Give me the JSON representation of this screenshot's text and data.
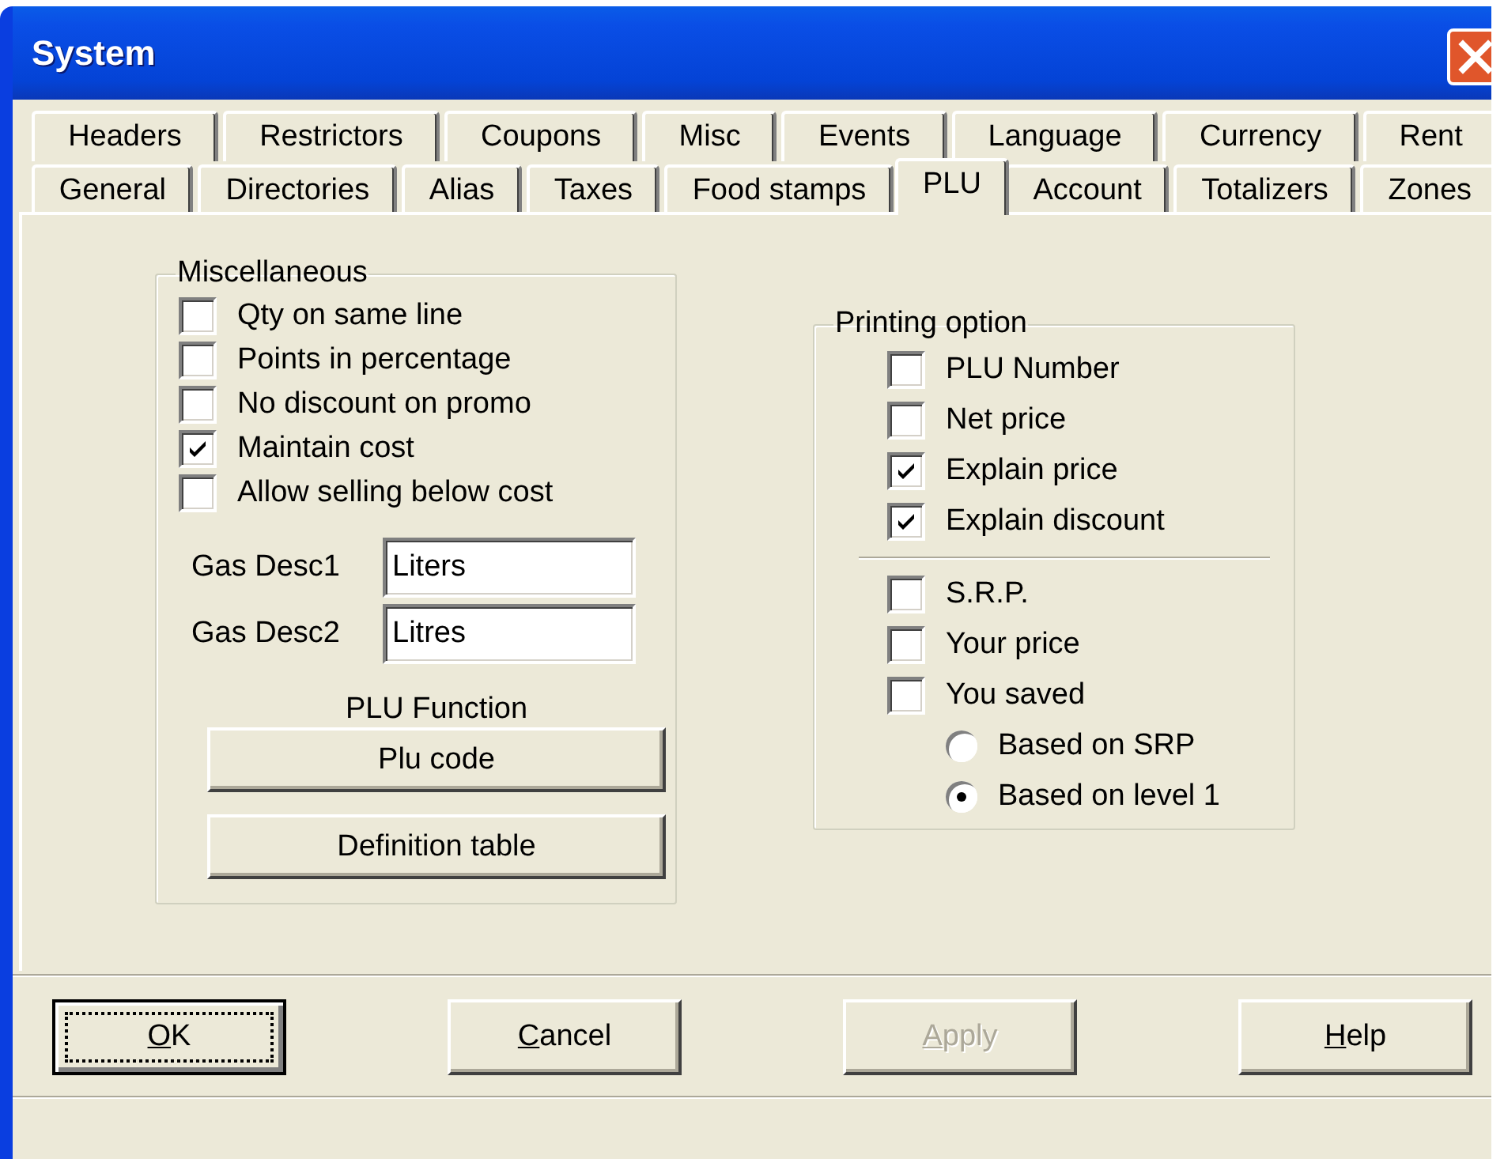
{
  "window": {
    "title": "System"
  },
  "tabs": {
    "rows": [
      {
        "tabs": [
          {
            "label": "Headers",
            "selected": false
          },
          {
            "label": "Restrictors",
            "selected": false
          },
          {
            "label": "Coupons",
            "selected": false
          },
          {
            "label": "Misc",
            "selected": false
          },
          {
            "label": "Events",
            "selected": false
          },
          {
            "label": "Language",
            "selected": false
          },
          {
            "label": "Currency",
            "selected": false
          },
          {
            "label": "Rent",
            "selected": false
          }
        ]
      },
      {
        "tabs": [
          {
            "label": "General",
            "selected": false
          },
          {
            "label": "Directories",
            "selected": false
          },
          {
            "label": "Alias",
            "selected": false
          },
          {
            "label": "Taxes",
            "selected": false
          },
          {
            "label": "Food stamps",
            "selected": false
          },
          {
            "label": "PLU",
            "selected": true
          },
          {
            "label": "Account",
            "selected": false
          },
          {
            "label": "Totalizers",
            "selected": false
          },
          {
            "label": "Zones",
            "selected": false
          }
        ]
      }
    ]
  },
  "miscellaneous": {
    "title": "Miscellaneous",
    "options": [
      {
        "label": "Qty on same line",
        "checked": false
      },
      {
        "label": "Points in percentage",
        "checked": false
      },
      {
        "label": "No discount on promo",
        "checked": false
      },
      {
        "label": "Maintain cost",
        "checked": true
      },
      {
        "label": "Allow selling below cost",
        "checked": false
      }
    ],
    "fields": [
      {
        "label": "Gas Desc1",
        "value": "Liters"
      },
      {
        "label": "Gas Desc2",
        "value": "Litres"
      }
    ],
    "plu_function": {
      "label": "PLU Function",
      "buttons": [
        "Plu code",
        "Definition table"
      ]
    }
  },
  "printing_option": {
    "title": "Printing option",
    "items": [
      {
        "kind": "checkbox",
        "label": "PLU Number",
        "checked": false
      },
      {
        "kind": "checkbox",
        "label": "Net price",
        "checked": false
      },
      {
        "kind": "checkbox",
        "label": "Explain price",
        "checked": true
      },
      {
        "kind": "checkbox",
        "label": "Explain discount",
        "checked": true
      },
      {
        "kind": "separator"
      },
      {
        "kind": "checkbox",
        "label": "S.R.P.",
        "checked": false
      },
      {
        "kind": "checkbox",
        "label": "Your price",
        "checked": false
      },
      {
        "kind": "checkbox",
        "label": "You saved",
        "checked": false
      },
      {
        "kind": "radio",
        "label": "Based on SRP",
        "selected": false
      },
      {
        "kind": "radio",
        "label": "Based on level 1",
        "selected": true
      }
    ]
  },
  "buttons": [
    {
      "label": "OK",
      "default": true,
      "disabled": false
    },
    {
      "label": "Cancel",
      "default": false,
      "disabled": false
    },
    {
      "label": "Apply",
      "default": false,
      "disabled": true
    },
    {
      "label": "Help",
      "default": false,
      "disabled": false
    }
  ]
}
